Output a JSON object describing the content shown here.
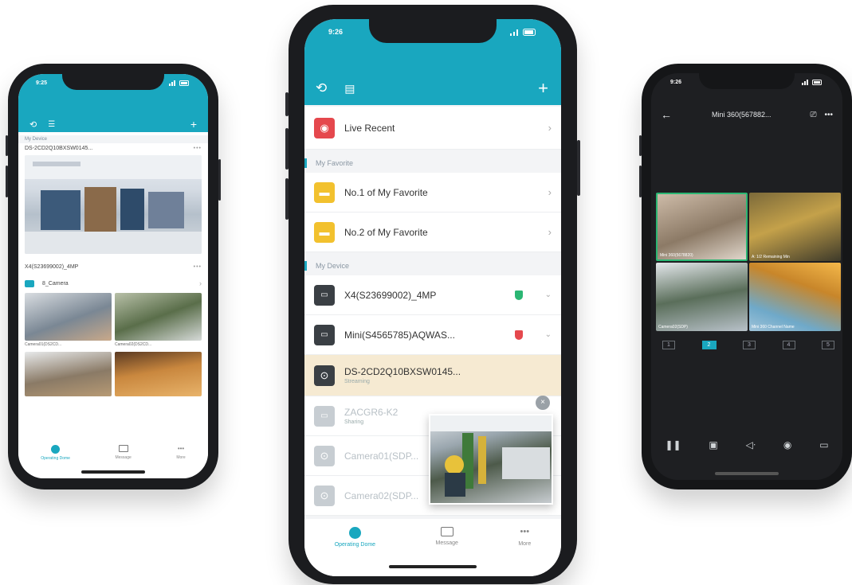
{
  "colors": {
    "accent": "#19a7bf",
    "live_red": "#e5484d",
    "folder_yellow": "#f2c12e",
    "dark_bg": "#1e1f22",
    "online": "#2bb673",
    "offline": "#e5484d"
  },
  "left_phone": {
    "status_time": "9:25",
    "section_my_device": "My Device",
    "device1_name": "DS-2CD2Q10BXSW0145...",
    "device2_name": "X4(S23699002)_4MP",
    "camera_group": "8_Camera",
    "thumbs": [
      "Camera01(DS2CD...",
      "Camera02(DS2CD..."
    ],
    "tabs": [
      "Operating Dome",
      "Message",
      "More"
    ]
  },
  "center_phone": {
    "status_time": "9:26",
    "live_recent": "Live Recent",
    "section_favorite": "My Favorite",
    "fav1": "No.1 of My Favorite",
    "fav2": "No.2 of My Favorite",
    "section_devices": "My Device",
    "dev1": "X4(S23699002)_4MP",
    "dev2": "Mini(S4565785)AQWAS...",
    "dev3": "DS-2CD2Q10BXSW0145...",
    "dev3_sub": "Streaming",
    "dev4": "ZACGR6-K2",
    "dev4_sub": "Sharing",
    "dev5": "Camera01(SDP...",
    "dev6": "Camera02(SDP...",
    "tabs": [
      "Operating Dome",
      "Message",
      "More"
    ]
  },
  "right_phone": {
    "status_time": "9:26",
    "title": "Mini 360(567882...",
    "tiles": [
      "Mini 360(5678820)",
      "A: 1/2 Remaining Min",
      "Camera02(SDP)",
      "Mini 360 Channel Name"
    ],
    "pages": [
      "1",
      "2",
      "3",
      "4",
      "5"
    ],
    "active_page": 1
  }
}
